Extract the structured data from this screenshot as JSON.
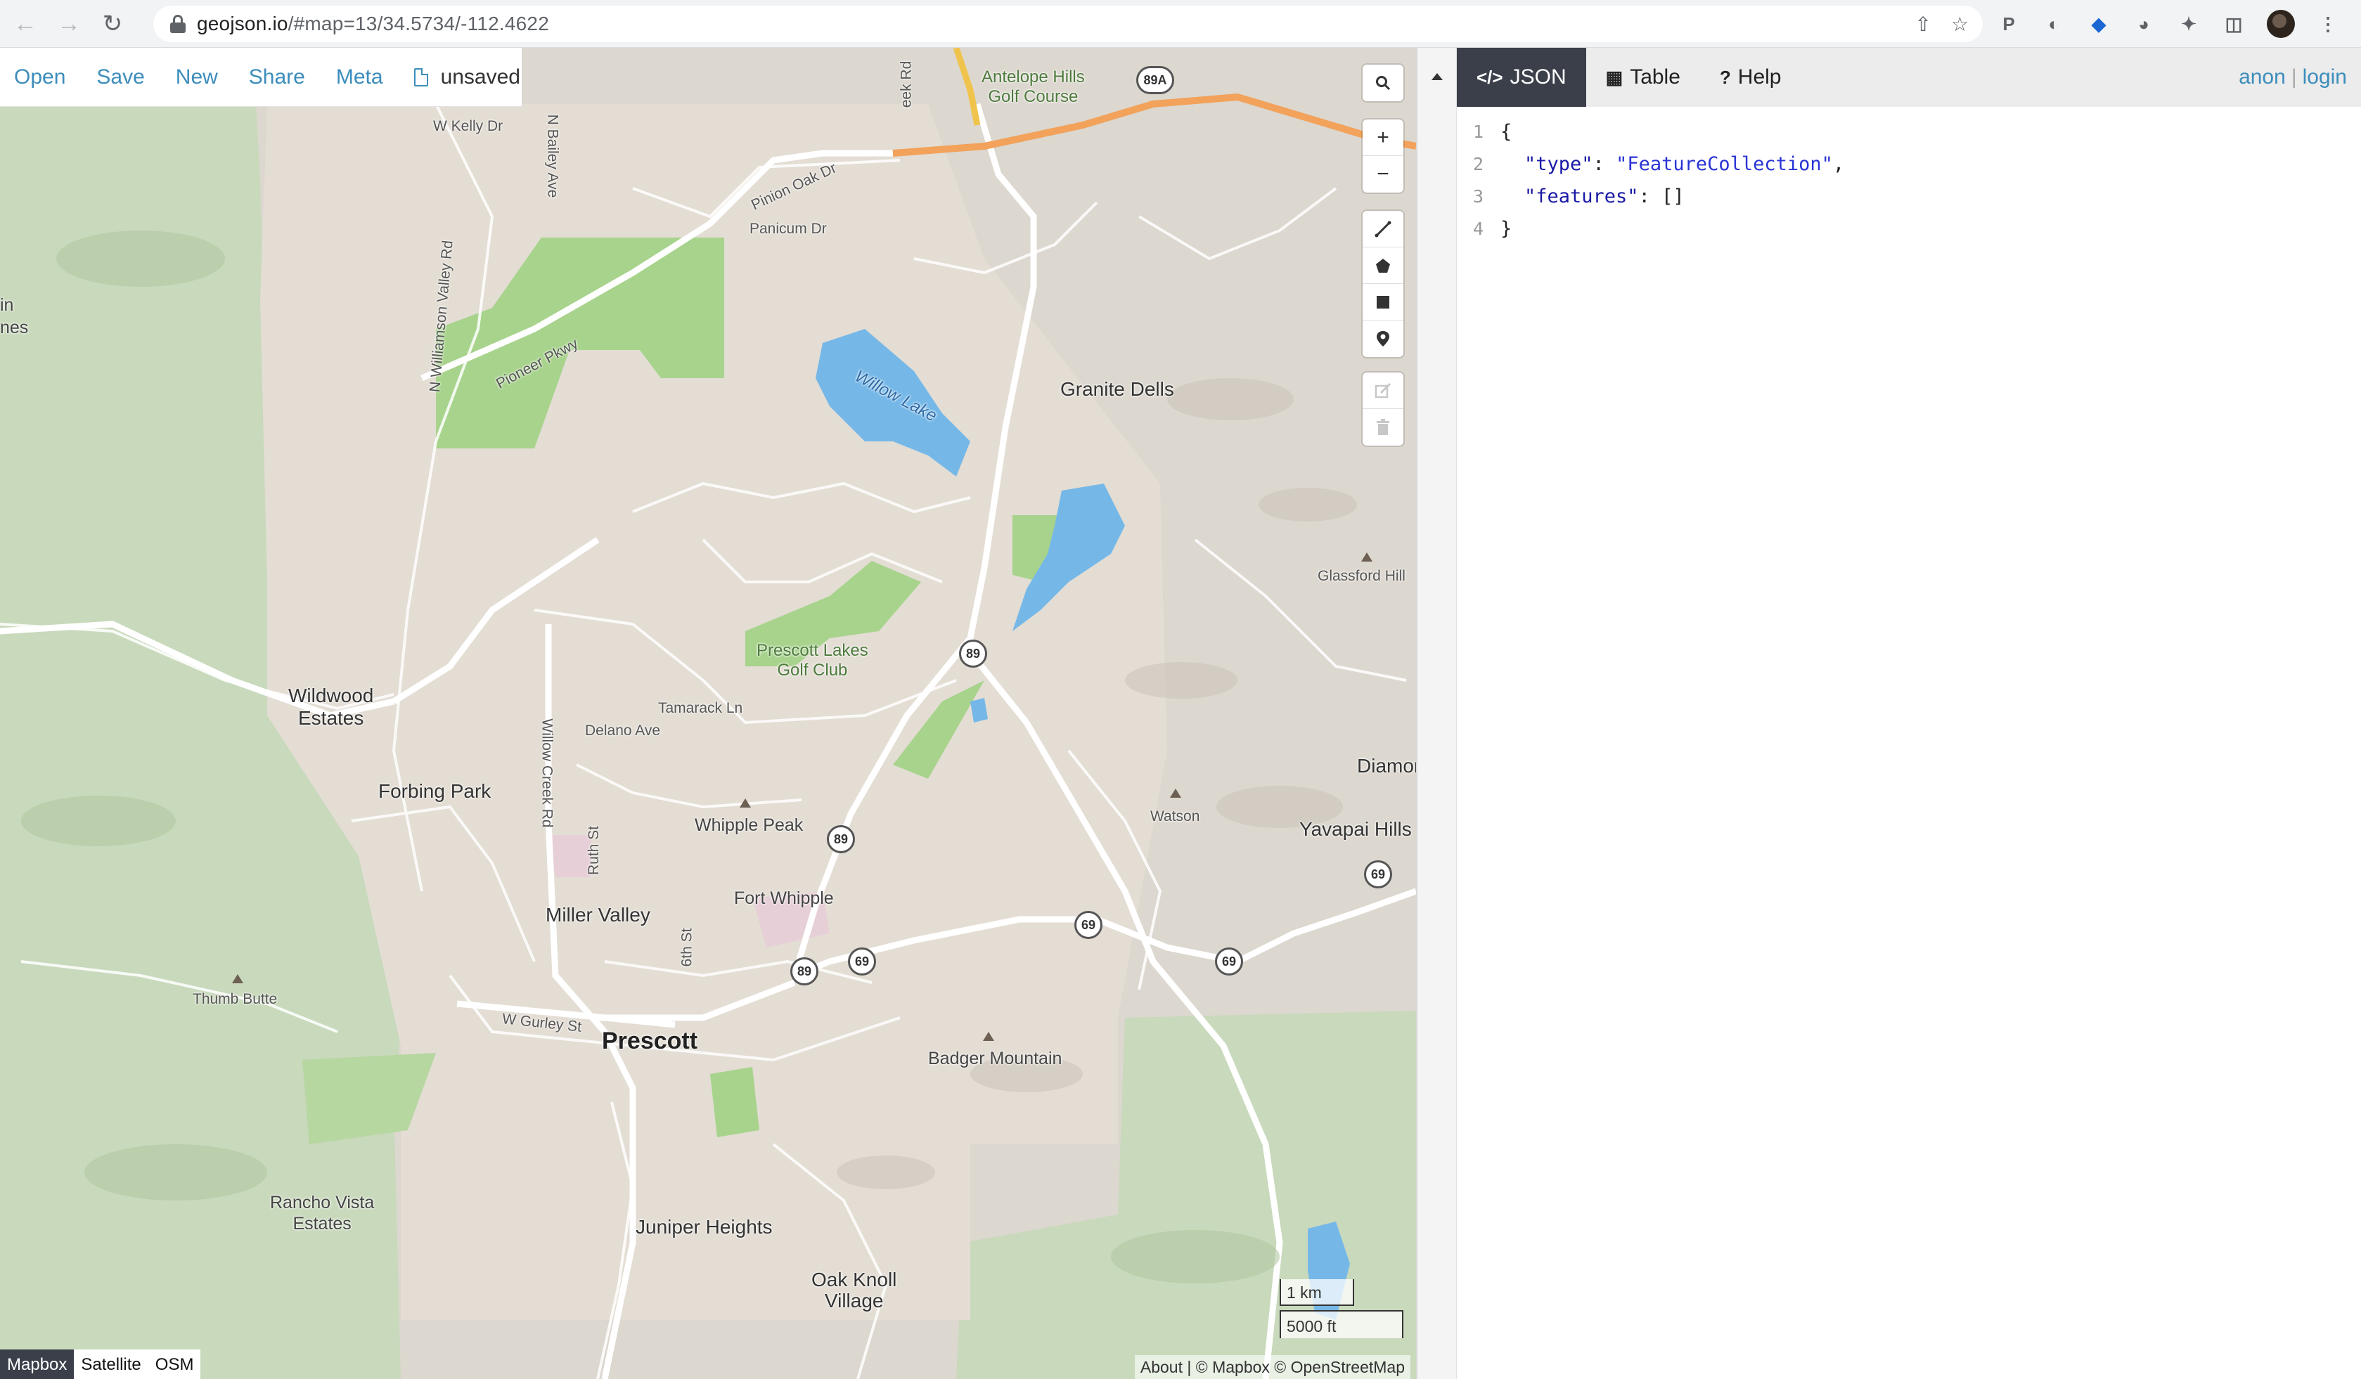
{
  "browser": {
    "url_host": "geojson.io",
    "url_path": "/#map=13/34.5734/-112.4622",
    "icons": [
      "back-icon",
      "forward-icon",
      "reload-icon",
      "lock-icon",
      "share-icon",
      "star-icon"
    ]
  },
  "map_nav": {
    "open": "Open",
    "save": "Save",
    "new": "New",
    "share": "Share",
    "meta": "Meta",
    "file_status": "unsaved"
  },
  "map_controls": {
    "zoom_in": "+",
    "zoom_out": "−"
  },
  "layer_switch": {
    "mapbox": "Mapbox",
    "satellite": "Satellite",
    "osm": "OSM",
    "active": "Mapbox"
  },
  "scale": {
    "metric": "1 km",
    "imperial": "5000 ft"
  },
  "attribution": "About | © Mapbox © OpenStreetMap",
  "map_labels": {
    "antelope": "Antelope Hills",
    "antelope2": "Golf Course",
    "kelly": "W Kelly Dr",
    "bailey": "N Bailey Ave",
    "pinion": "Pinion Oak Dr",
    "panicum": "Panicum Dr",
    "williamson": "N Williamson Valley Rd",
    "pioneer": "Pioneer Pkwy",
    "willow_lake": "Willow Lake",
    "granite_dells": "Granite Dells",
    "glassford": "Glassford Hill",
    "prescott_lakes": "Prescott Lakes",
    "prescott_lakes2": "Golf Club",
    "wildwood": "Wildwood",
    "wildwood2": "Estates",
    "tamarack": "Tamarack Ln",
    "delano": "Delano Ave",
    "willow_creek": "Willow Creek Rd",
    "forbing": "Forbing Park",
    "whipple_peak": "Whipple Peak",
    "watson": "Watson",
    "yavapai": "Yavapai Hills",
    "diamond": "Diamor",
    "ruth": "Ruth St",
    "miller": "Miller Valley",
    "fort_whipple": "Fort Whipple",
    "sixth": "6th St",
    "thumb": "Thumb Butte",
    "gurley": "W Gurley St",
    "prescott": "Prescott",
    "badger": "Badger Mountain",
    "rancho": "Rancho Vista",
    "rancho2": "Estates",
    "juniper": "Juniper Heights",
    "oak_knoll": "Oak Knoll",
    "oak_knoll2": "Village",
    "edge_in": "in",
    "edge_nes": "nes",
    "creek_rd": "eek Rd"
  },
  "highway_shields": {
    "h89a": "89A",
    "h89": "89",
    "h69": "69"
  },
  "editor": {
    "tab_json": "JSON",
    "tab_table": "Table",
    "tab_help": "Help",
    "active_tab": "JSON",
    "anon": "anon",
    "separator": "|",
    "login": "login",
    "lines": [
      {
        "n": "1",
        "text": "{"
      },
      {
        "n": "2",
        "key": "\"type\"",
        "colon": ": ",
        "val": "\"FeatureCollection\"",
        "tail": ","
      },
      {
        "n": "3",
        "key": "\"features\"",
        "colon": ": ",
        "val": "[]",
        "tail": ""
      },
      {
        "n": "4",
        "text": "}"
      }
    ]
  },
  "colors": {
    "link": "#3c8dbc",
    "active_tab": "#3a3f4a",
    "water": "#75b8e8",
    "park": "#a8d38c",
    "highway": "#f2a25a"
  }
}
